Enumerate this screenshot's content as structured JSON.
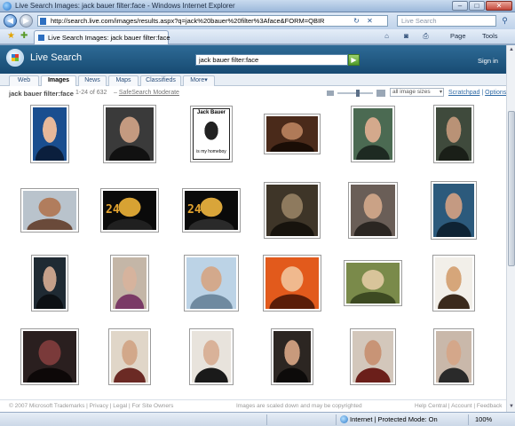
{
  "window": {
    "title": "Live Search Images: jack bauer filter:face - Windows Internet Explorer",
    "minimize": "–",
    "maximize": "□",
    "close": "✕"
  },
  "toolbar": {
    "url": "http://search.live.com/images/results.aspx?q=jack%20bauer%20filter%3Aface&FORM=QBIR",
    "search_placeholder": "Live Search",
    "back_glyph": "◀",
    "forward_glyph": "▶",
    "refresh_glyph": "↻",
    "stop_glyph": "✕",
    "go_glyph": "⚲"
  },
  "tabs": {
    "active_label": "Live Search Images: jack bauer filter:face",
    "page_label": "Page",
    "tools_label": "Tools",
    "home_glyph": "⌂",
    "feeds_glyph": "◙",
    "print_glyph": "⎙"
  },
  "live_search": {
    "brand": "Live Search",
    "query": "jack bauer filter:face",
    "go_glyph": "▶",
    "sign_in": "Sign in",
    "scopes": [
      "Web",
      "Images",
      "News",
      "Maps",
      "Classifieds",
      "More▾"
    ],
    "active_scope": "Images"
  },
  "results": {
    "query": "jack bauer filter:face",
    "count": "1-24 of 632",
    "safesearch": "SafeSearch Moderate",
    "size_filter": "all image sizes",
    "scratchpad": "Scratchpad",
    "options": "Options",
    "thumbnails": [
      {
        "colors": [
          "#1a4e8f",
          "#e6b89a",
          "#0b1f3d"
        ]
      },
      {
        "colors": [
          "#3a3a3a",
          "#c49a80",
          "#111111"
        ]
      },
      {
        "colors": [
          "#ffffff",
          "#333333",
          "#ffffff"
        ]
      },
      {
        "colors": [
          "#4a2a1a",
          "#b07a58",
          "#1a0d06"
        ]
      },
      {
        "colors": [
          "#4b6a52",
          "#d4a98c",
          "#1e2a22"
        ]
      },
      {
        "colors": [
          "#3f4a3c",
          "#b99276",
          "#1a1f18"
        ]
      },
      {
        "colors": [
          "#b9c3cc",
          "#b17d5d",
          "#6a4a3a"
        ]
      },
      {
        "colors": [
          "#0a0a0a",
          "#d7a233",
          "#202020"
        ]
      },
      {
        "colors": [
          "#0a0a0a",
          "#d9a53a",
          "#2a2a2a"
        ]
      },
      {
        "colors": [
          "#3e3528",
          "#8e7a5e",
          "#17130d"
        ]
      },
      {
        "colors": [
          "#6a5e57",
          "#caa286",
          "#2b2622"
        ]
      },
      {
        "colors": [
          "#2c5a7c",
          "#c49a82",
          "#0e2334"
        ]
      },
      {
        "colors": [
          "#1f2a33",
          "#c5a08a",
          "#0c1014"
        ]
      },
      {
        "colors": [
          "#c4b6a7",
          "#d6b39d",
          "#7a3a66"
        ]
      },
      {
        "colors": [
          "#bcd3e6",
          "#d3a98c",
          "#6f8aa0"
        ]
      },
      {
        "colors": [
          "#e25a1c",
          "#f0b98e",
          "#5a1d08"
        ]
      },
      {
        "colors": [
          "#7a8a4a",
          "#d8c49a",
          "#3d4a22"
        ]
      },
      {
        "colors": [
          "#f2efe9",
          "#d6a67a",
          "#3b2a1c"
        ]
      },
      {
        "colors": [
          "#2a1f1f",
          "#7a3a3a",
          "#0d0808"
        ]
      },
      {
        "colors": [
          "#e0d6c8",
          "#d2a88a",
          "#6b2a24"
        ]
      },
      {
        "colors": [
          "#e8e3dc",
          "#d9b299",
          "#1a1a1a"
        ]
      },
      {
        "colors": [
          "#2c2622",
          "#c89a7c",
          "#0d0b0a"
        ]
      },
      {
        "colors": [
          "#d3c7bb",
          "#c89476",
          "#6b1f1a"
        ]
      },
      {
        "colors": [
          "#c9b8aa",
          "#d4a78a",
          "#2a2a2a"
        ]
      }
    ],
    "thumb_captions": {
      "2": "Jack Bauer",
      "2b": "is my homeboy"
    }
  },
  "footer": {
    "left": "© 2007 Microsoft  Trademarks | Privacy | Legal | For Site Owners",
    "middle": "Images are scaled down and may be copyrighted",
    "right": "Help Central | Account | Feedback"
  },
  "status": {
    "zone": "Internet | Protected Mode: On",
    "zoom": "100%"
  }
}
